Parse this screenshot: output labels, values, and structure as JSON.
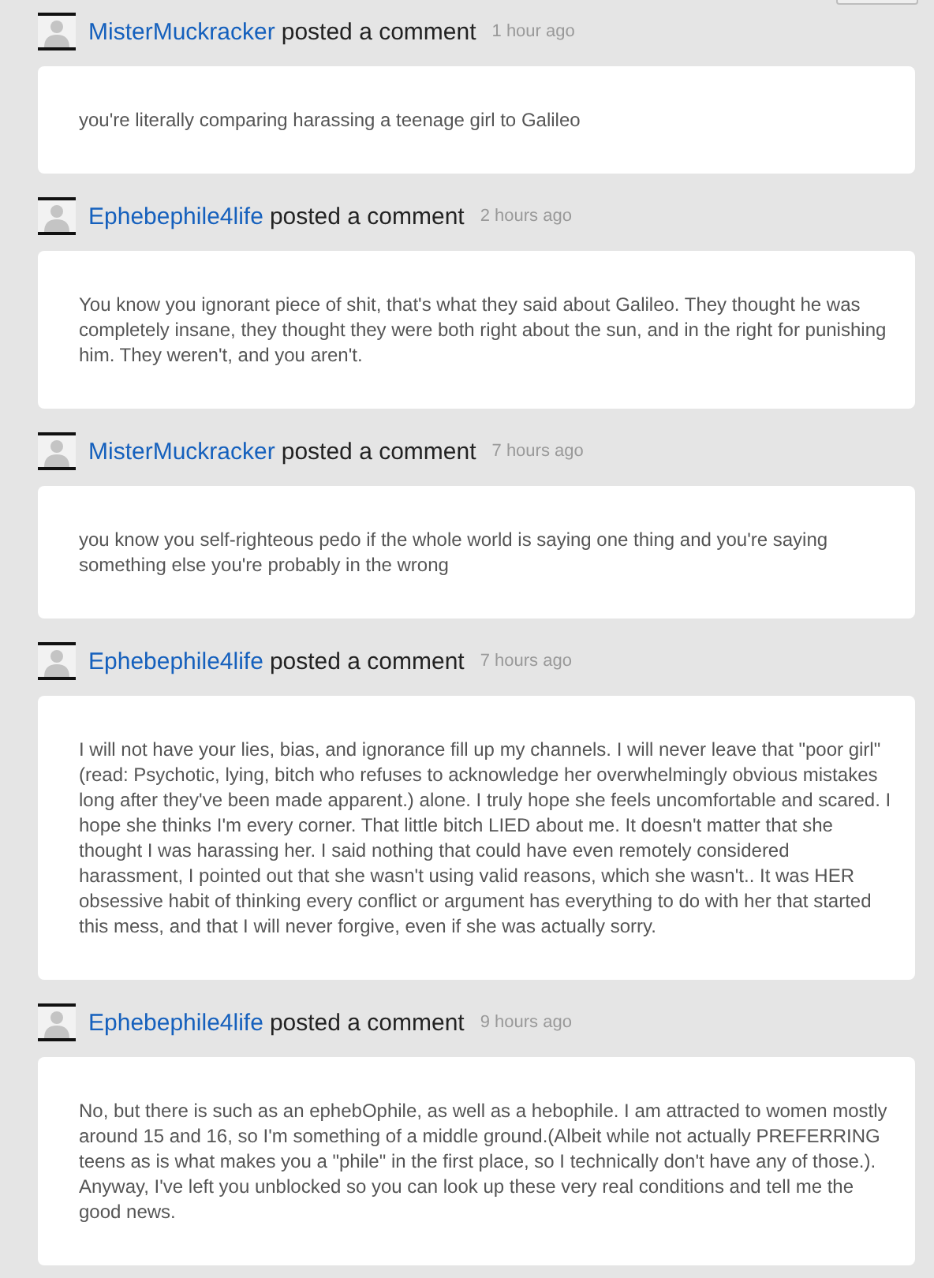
{
  "comments": [
    {
      "author": "MisterMuckracker",
      "action": "posted a comment",
      "time": "1 hour ago",
      "text": "you're literally comparing harassing a teenage girl to Galileo"
    },
    {
      "author": "Ephebephile4life",
      "action": "posted a comment",
      "time": "2 hours ago",
      "text": "You know you ignorant piece of shit, that's what they said about Galileo. They thought he was completely insane, they thought they were both right about the sun, and in the right for punishing him. They weren't, and you aren't."
    },
    {
      "author": "MisterMuckracker",
      "action": "posted a comment",
      "time": "7 hours ago",
      "text": "you know you self-righteous pedo if the whole world is saying one thing and you're saying something else you're probably in the wrong"
    },
    {
      "author": "Ephebephile4life",
      "action": "posted a comment",
      "time": "7 hours ago",
      "text": "I will not have your lies, bias, and ignorance fill up my channels. I will never leave that \"poor girl\" (read: Psychotic, lying, bitch who refuses to acknowledge her overwhelmingly obvious mistakes long after they've been made apparent.) alone. I truly hope she feels uncomfortable and scared. I hope she thinks I'm every corner. That little bitch LIED about me. It doesn't matter that she thought I was harassing her. I said nothing that could have even remotely considered harassment, I pointed out that she wasn't using valid reasons, which she wasn't.. It was HER obsessive habit of thinking every conflict or argument has everything to do with her that started this mess, and that I will never forgive, even if she was actually sorry."
    },
    {
      "author": "Ephebephile4life",
      "action": "posted a comment",
      "time": "9 hours ago",
      "text": "No, but there is such as an ephebOphile, as well as a hebophile. I am attracted to women mostly around 15 and 16, so I'm something of a middle ground.(Albeit while not actually PREFERRING teens as is what makes you a \"phile\" in the first place, so I technically don't have any of those.). Anyway, I've left you unblocked so you can look up these very real conditions and tell me the good news."
    }
  ]
}
